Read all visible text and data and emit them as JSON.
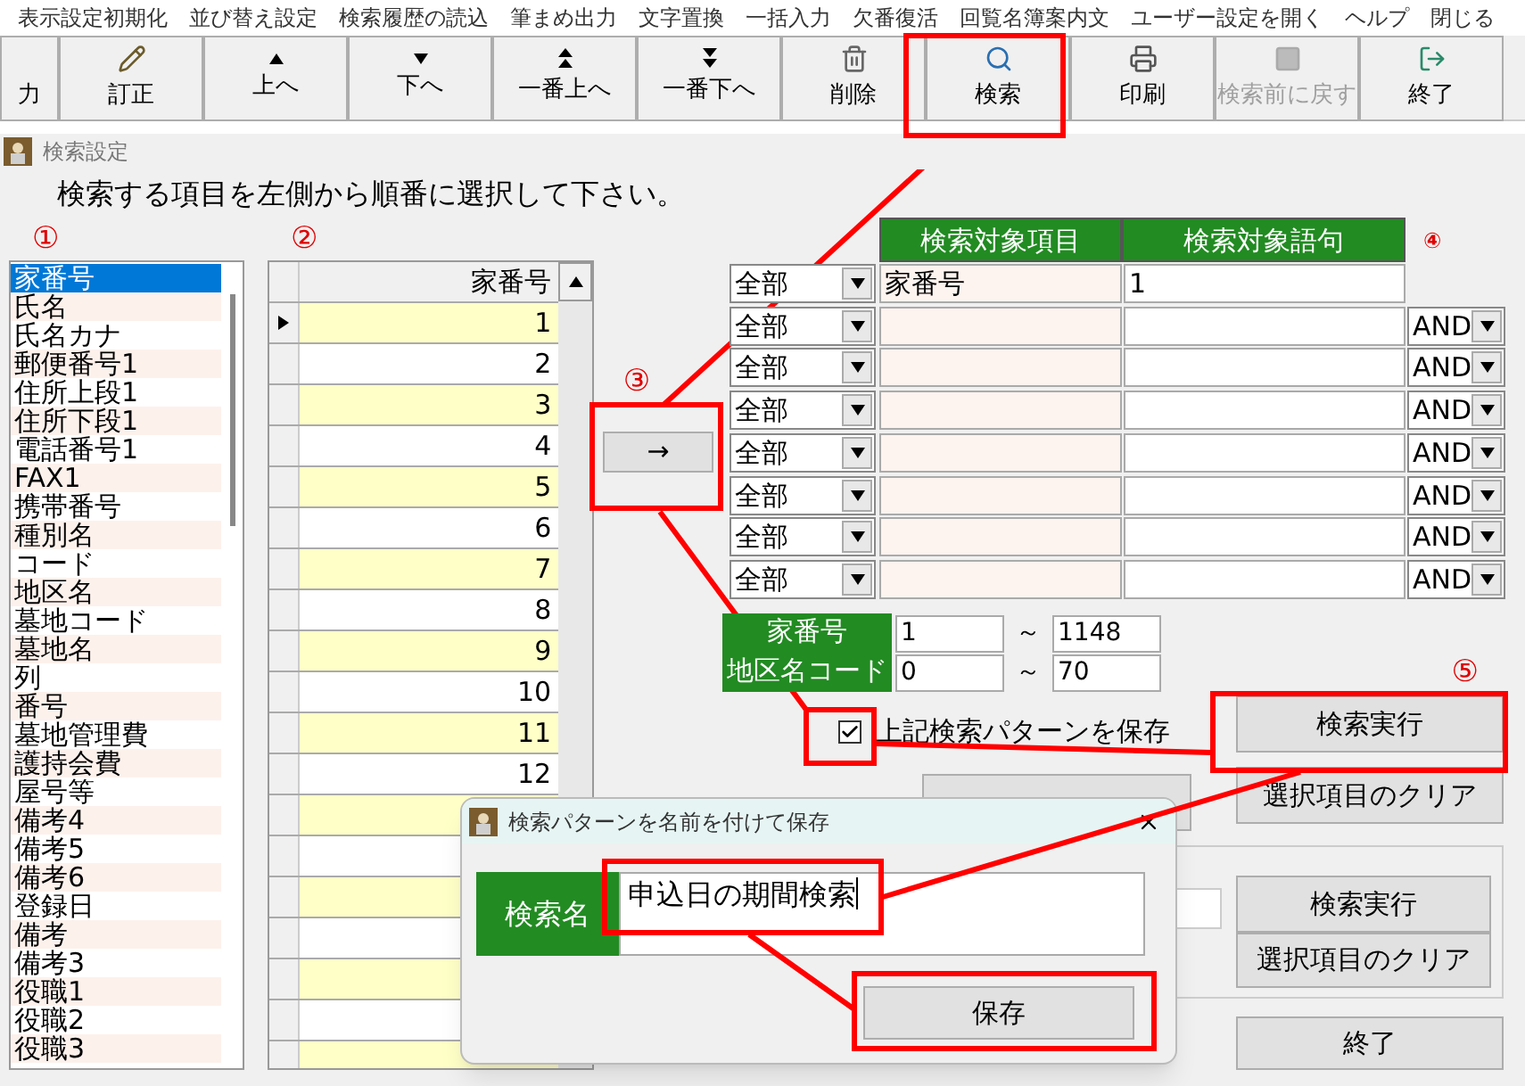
{
  "menu": [
    "表示設定初期化",
    "並び替え設定",
    "検索履歴の読込",
    "筆まめ出力",
    "文字置換",
    "一括入力",
    "欠番復活",
    "回覧名簿案内文",
    "ユーザー設定を開く",
    "ヘルプ",
    "閉じる"
  ],
  "toolbar": [
    {
      "label": "力",
      "kind": "none",
      "disabled": false
    },
    {
      "label": "訂正",
      "kind": "pencil",
      "disabled": false
    },
    {
      "label": "上へ",
      "kind": "up",
      "disabled": false
    },
    {
      "label": "下へ",
      "kind": "down",
      "disabled": false
    },
    {
      "label": "一番上へ",
      "kind": "top",
      "disabled": false
    },
    {
      "label": "一番下へ",
      "kind": "bottom",
      "disabled": false
    },
    {
      "label": "削除",
      "kind": "trash",
      "disabled": false
    },
    {
      "label": "検索",
      "kind": "search",
      "disabled": false
    },
    {
      "label": "印刷",
      "kind": "printer",
      "disabled": false
    },
    {
      "label": "検索前に戻す",
      "kind": "square",
      "disabled": true
    },
    {
      "label": "終了",
      "kind": "exit",
      "disabled": false
    }
  ],
  "window": {
    "title": "検索設定"
  },
  "instruction": "検索する項目を左側から順番に選択して下さい。",
  "markers": [
    "①",
    "②",
    "③",
    "④",
    "⑤"
  ],
  "fields": [
    {
      "label": "家番号",
      "selected": true
    },
    {
      "label": "氏名",
      "selected": false
    },
    {
      "label": "氏名カナ",
      "selected": false
    },
    {
      "label": "郵便番号1",
      "selected": false
    },
    {
      "label": "住所上段1",
      "selected": false
    },
    {
      "label": "住所下段1",
      "selected": false
    },
    {
      "label": "電話番号1",
      "selected": false
    },
    {
      "label": "FAX1",
      "selected": false
    },
    {
      "label": "携帯番号",
      "selected": false
    },
    {
      "label": "種別名",
      "selected": false
    },
    {
      "label": "コード",
      "selected": false
    },
    {
      "label": "地区名",
      "selected": false
    },
    {
      "label": "墓地コード",
      "selected": false
    },
    {
      "label": "墓地名",
      "selected": false
    },
    {
      "label": "列",
      "selected": false
    },
    {
      "label": "番号",
      "selected": false
    },
    {
      "label": "墓地管理費",
      "selected": false
    },
    {
      "label": "護持会費",
      "selected": false
    },
    {
      "label": "屋号等",
      "selected": false
    },
    {
      "label": "備考4",
      "selected": false
    },
    {
      "label": "備考5",
      "selected": false
    },
    {
      "label": "備考6",
      "selected": false
    },
    {
      "label": "登録日",
      "selected": false
    },
    {
      "label": "備考",
      "selected": false
    },
    {
      "label": "備考3",
      "selected": false
    },
    {
      "label": "役職1",
      "selected": false
    },
    {
      "label": "役職2",
      "selected": false
    },
    {
      "label": "役職3",
      "selected": false
    }
  ],
  "grid": {
    "column": "家番号",
    "rows": [
      {
        "value": "1",
        "current": true
      },
      {
        "value": "2",
        "current": false
      },
      {
        "value": "3",
        "current": false
      },
      {
        "value": "4",
        "current": false
      },
      {
        "value": "5",
        "current": false
      },
      {
        "value": "6",
        "current": false
      },
      {
        "value": "7",
        "current": false
      },
      {
        "value": "8",
        "current": false
      },
      {
        "value": "9",
        "current": false
      },
      {
        "value": "10",
        "current": false
      },
      {
        "value": "11",
        "current": false
      },
      {
        "value": "12",
        "current": false
      }
    ]
  },
  "add_button": "→",
  "criteria": {
    "columns": [
      "検索対象項目",
      "検索対象語句"
    ],
    "rows": [
      {
        "scope": "全部",
        "item": "家番号",
        "term": "1"
      },
      {
        "scope": "全部",
        "conjunction": "AND"
      },
      {
        "scope": "全部",
        "conjunction": "AND"
      },
      {
        "scope": "全部",
        "conjunction": "AND"
      },
      {
        "scope": "全部",
        "conjunction": "AND"
      },
      {
        "scope": "全部",
        "conjunction": "AND"
      },
      {
        "scope": "全部",
        "conjunction": "AND"
      },
      {
        "scope": "全部",
        "conjunction": "AND"
      }
    ]
  },
  "ranges": [
    {
      "label": "家番号",
      "from": "1",
      "sep": "～",
      "to": "1148"
    },
    {
      "label": "地区名コード",
      "from": "0",
      "sep": "～",
      "to": "70"
    }
  ],
  "save_pattern": {
    "label": "上記検索パターンを保存",
    "checked": true
  },
  "buttons": {
    "run": "検索実行",
    "clear": "選択項目のクリア"
  },
  "panel": {
    "run": "検索実行",
    "clear": "選択項目のクリア"
  },
  "exit": "終了",
  "dialog": {
    "title": "検索パターンを名前を付けて保存",
    "label": "検索名",
    "value": "申込日の期間検索",
    "save": "保存"
  }
}
